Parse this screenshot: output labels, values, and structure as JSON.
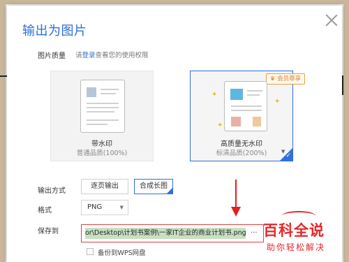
{
  "dialog": {
    "title": "输出为图片",
    "quality": {
      "label": "图片质量",
      "note_prefix": "请",
      "login_link": "登录",
      "note_suffix": "查看您的使用权限"
    },
    "cards": [
      {
        "title": "带水印",
        "subtitle": "普通品质(100%)",
        "selected": false
      },
      {
        "title": "高质量无水印",
        "subtitle": "标清品质(200%)",
        "selected": true,
        "badge": "会员尊享"
      }
    ],
    "output_mode": {
      "label": "输出方式",
      "options": [
        "逐页输出",
        "合成长图"
      ],
      "selected": "合成长图"
    },
    "format": {
      "label": "格式",
      "value": "PNG"
    },
    "save_to": {
      "label": "保存到",
      "path": "or\\Desktop\\计划书案例\\一家IT企业的商业计划书.png",
      "more": "..."
    },
    "backup": {
      "label": "备份到WPS网盘",
      "checked": false
    }
  },
  "watermark": {
    "main": "百科全说",
    "sub": "助你轻松解决"
  },
  "colors": {
    "accent": "#2f6fe0",
    "title": "#2d6fd6",
    "highlight_border": "#e34141",
    "watermark": "#e8262a"
  }
}
